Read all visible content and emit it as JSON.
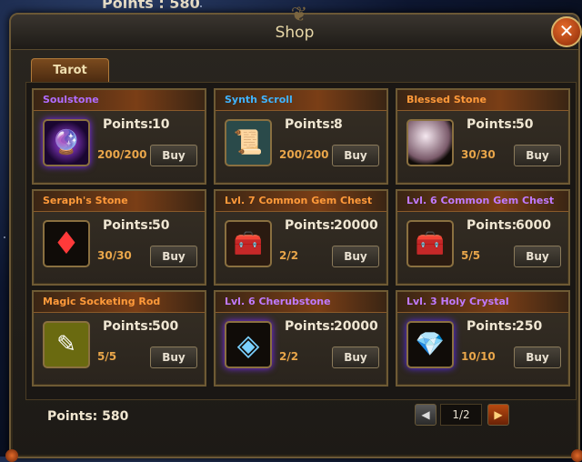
{
  "background": {
    "top_points": "Points : 580"
  },
  "window": {
    "title": "Shop",
    "close_label": "✕"
  },
  "tabs": [
    {
      "label": "Tarot"
    }
  ],
  "items": [
    {
      "name": "Soulstone",
      "name_color": "#b06cff",
      "points_label": "Points:",
      "points": "10",
      "stock": "200/200",
      "buy_label": "Buy",
      "icon": "purple-orb-icon",
      "glyph": "🔮"
    },
    {
      "name": "Synth Scroll",
      "name_color": "#3fb4ff",
      "points_label": "Points:",
      "points": "8",
      "stock": "200/200",
      "buy_label": "Buy",
      "icon": "scroll-icon",
      "glyph": "📜"
    },
    {
      "name": "Blessed Stone",
      "name_color": "#ff9a3a",
      "points_label": "Points:",
      "points": "50",
      "stock": "30/30",
      "buy_label": "Buy",
      "icon": "pearl-icon",
      "glyph": "⚪"
    },
    {
      "name": "Seraph's Stone",
      "name_color": "#ff9a3a",
      "points_label": "Points:",
      "points": "50",
      "stock": "30/30",
      "buy_label": "Buy",
      "icon": "red-crystal-icon",
      "glyph": "♦"
    },
    {
      "name": "Lvl. 7 Common Gem Chest",
      "name_color": "#ff9a3a",
      "points_label": "Points:",
      "points": "20000",
      "stock": "2/2",
      "buy_label": "Buy",
      "icon": "chest-icon",
      "glyph": "🧰"
    },
    {
      "name": "Lvl. 6 Common Gem Chest",
      "name_color": "#c07aff",
      "points_label": "Points:",
      "points": "6000",
      "stock": "5/5",
      "buy_label": "Buy",
      "icon": "chest-icon",
      "glyph": "🧰"
    },
    {
      "name": "Magic Socketing Rod",
      "name_color": "#ff9a3a",
      "points_label": "Points:",
      "points": "500",
      "stock": "5/5",
      "buy_label": "Buy",
      "icon": "rod-icon",
      "glyph": "✎"
    },
    {
      "name": "Lvl. 6 Cherubstone",
      "name_color": "#c07aff",
      "points_label": "Points:",
      "points": "20000",
      "stock": "2/2",
      "buy_label": "Buy",
      "icon": "square-gem-icon",
      "glyph": "◈"
    },
    {
      "name": "Lvl. 3 Holy Crystal",
      "name_color": "#c07aff",
      "points_label": "Points:",
      "points": "250",
      "stock": "10/10",
      "buy_label": "Buy",
      "icon": "violet-gem-icon",
      "glyph": "💎"
    }
  ],
  "footer": {
    "points_label": "Points:",
    "points": "580"
  },
  "pager": {
    "page": "1/2",
    "prev": "◀",
    "next": "▶"
  }
}
